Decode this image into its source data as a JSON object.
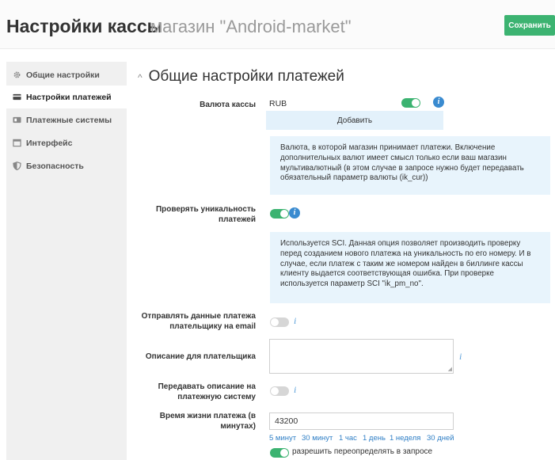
{
  "header": {
    "title": "Настройки кассы",
    "subtitle": "магазин \"Android-market\"",
    "save_label": "Сохранить"
  },
  "sidebar": {
    "items": [
      {
        "label": "Общие настройки",
        "icon": "gear-icon"
      },
      {
        "label": "Настройки платежей",
        "icon": "card-icon",
        "active": true
      },
      {
        "label": "Платежные системы",
        "icon": "wallet-icon"
      },
      {
        "label": "Интерфейс",
        "icon": "window-icon"
      },
      {
        "label": "Безопасность",
        "icon": "shield-icon"
      }
    ]
  },
  "section": {
    "title": "Общие настройки платежей",
    "chevron": "^"
  },
  "fields": {
    "currency": {
      "label": "Валюта кассы",
      "value": "RUB",
      "enabled": true,
      "add_label": "Добавить",
      "help": "Валюта, в которой магазин принимает платежи. Включение дополнительных валют имеет смысл только если ваш магазин мультивалютный (в этом случае в запросе нужно будет передавать обязательный параметр валюты (ik_cur))"
    },
    "unique": {
      "label": "Проверять уникальность платежей",
      "enabled": true,
      "help": "Используется SCI. Данная опция позволяет производить проверку перед созданием нового платежа на уникальность по его номеру. И в случае, если платеж с таким же номером найден в биллинге кассы клиенту выдается соответствующая ошибка. При проверке используется параметр SCI \"ik_pm_no\"."
    },
    "email": {
      "label": "Отправлять данные платежа плательщику на email",
      "enabled": false
    },
    "description": {
      "label": "Описание для плательщика",
      "value": ""
    },
    "pass_description": {
      "label": "Передавать описание на платежную систему",
      "enabled": false
    },
    "lifetime": {
      "label": "Время жизни платежа (в минутах)",
      "value": "43200",
      "presets": [
        "5 минут",
        "30 минут",
        "1 час",
        "1 день",
        "1 неделя",
        "30 дней"
      ],
      "override_label": "разрешить переопределять в запросе",
      "override_enabled": true
    }
  },
  "icons": {
    "info": "i",
    "resize_grip": "◢"
  },
  "colors": {
    "accent": "#3cb371",
    "info": "#3a8bd0",
    "link": "#2f7fc6",
    "help_bg": "#e8f4fc"
  }
}
